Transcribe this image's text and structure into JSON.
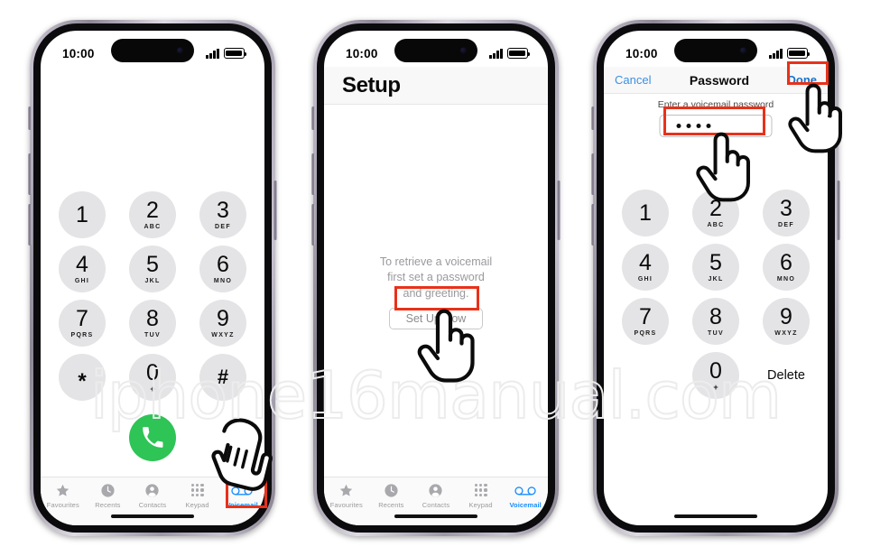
{
  "watermark": {
    "text": "iphone16manual.com"
  },
  "status_bar": {
    "time": "10:00",
    "signal_icon": "cellular-signal-icon",
    "battery_icon": "battery-icon"
  },
  "keypad": {
    "keys": [
      {
        "num": "1",
        "sub": ""
      },
      {
        "num": "2",
        "sub": "ABC"
      },
      {
        "num": "3",
        "sub": "DEF"
      },
      {
        "num": "4",
        "sub": "GHI"
      },
      {
        "num": "5",
        "sub": "JKL"
      },
      {
        "num": "6",
        "sub": "MNO"
      },
      {
        "num": "7",
        "sub": "PQRS"
      },
      {
        "num": "8",
        "sub": "TUV"
      },
      {
        "num": "9",
        "sub": "WXYZ"
      },
      {
        "num": "✳",
        "sub": ""
      },
      {
        "num": "0",
        "sub": "+"
      },
      {
        "num": "#",
        "sub": ""
      }
    ],
    "delete_label": "Delete",
    "call_button_icon": "phone-call-icon"
  },
  "tab_bar": {
    "items": [
      {
        "label": "Favourites",
        "icon": "star-icon",
        "active": false
      },
      {
        "label": "Recents",
        "icon": "clock-icon",
        "active": false
      },
      {
        "label": "Contacts",
        "icon": "person-circle-icon",
        "active": false
      },
      {
        "label": "Keypad",
        "icon": "keypad-dots-icon",
        "active": false
      },
      {
        "label": "Voicemail",
        "icon": "voicemail-icon",
        "active": true
      }
    ],
    "active_color": "#1a8cff",
    "inactive_color": "#9b9b9f"
  },
  "phone1": {
    "screen_name": "Keypad screen"
  },
  "phone2": {
    "nav_title": "Setup",
    "message_line1": "To retrieve a voicemail",
    "message_line2": "first set a password",
    "message_line3": "and greeting.",
    "setup_button_label": "Set Up Now"
  },
  "phone3": {
    "nav_cancel": "Cancel",
    "nav_title": "Password",
    "nav_done": "Done",
    "field_label": "Enter a voicemail password",
    "password_dots": 4,
    "delete_label": "Delete"
  },
  "annotations": {
    "highlight_color": "#e8311a",
    "cursor_icon": "pointing-hand-cursor"
  }
}
